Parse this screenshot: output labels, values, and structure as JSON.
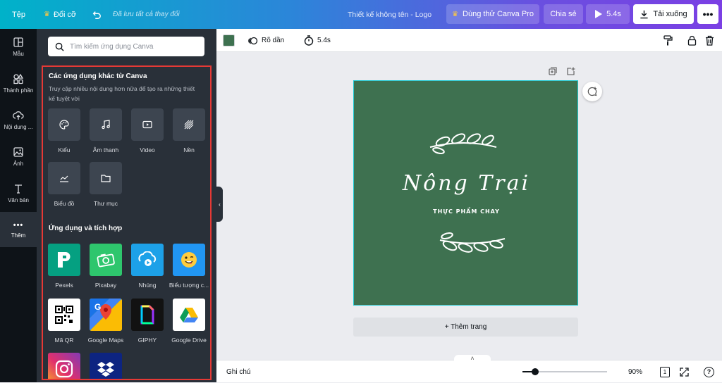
{
  "topbar": {
    "file_label": "Tệp",
    "resize_label": "Đổi cỡ",
    "saved_status": "Đã lưu tất cả thay đổi",
    "doc_title": "Thiết kế không tên - Logo",
    "try_pro_label": "Dùng thử Canva Pro",
    "share_label": "Chia sẻ",
    "play_duration": "5.4s",
    "download_label": "Tải xuống"
  },
  "rail": {
    "items": [
      {
        "label": "Mẫu",
        "icon": "template-icon"
      },
      {
        "label": "Thành phần",
        "icon": "elements-icon"
      },
      {
        "label": "Nội dung ...",
        "icon": "upload-icon"
      },
      {
        "label": "Ảnh",
        "icon": "photo-icon"
      },
      {
        "label": "Văn bản",
        "icon": "text-icon"
      },
      {
        "label": "Thêm",
        "icon": "more-icon"
      }
    ]
  },
  "panel": {
    "search_placeholder": "Tìm kiếm ứng dụng Canva",
    "section1_title": "Các ứng dụng khác từ Canva",
    "section1_desc": "Truy cập nhiều nội dung hơn nữa để tạo ra những thiết kế tuyệt vời",
    "tools": [
      {
        "label": "Kiểu",
        "icon": "palette-icon"
      },
      {
        "label": "Âm thanh",
        "icon": "music-icon"
      },
      {
        "label": "Video",
        "icon": "video-icon"
      },
      {
        "label": "Nền",
        "icon": "background-pattern-icon"
      },
      {
        "label": "Biểu đồ",
        "icon": "chart-icon"
      },
      {
        "label": "Thư mục",
        "icon": "folder-icon"
      }
    ],
    "section2_title": "Ứng dụng và tích hợp",
    "apps": [
      {
        "label": "Pexels",
        "color": "#05a081"
      },
      {
        "label": "Pixabay",
        "color": "#2ec66d"
      },
      {
        "label": "Nhúng",
        "color": "#1da1e8"
      },
      {
        "label": "Biểu tượng c...",
        "color": "#2196f3"
      },
      {
        "label": "Mã QR",
        "color": "#ffffff"
      },
      {
        "label": "Google Maps",
        "color": "#ffffff"
      },
      {
        "label": "GIPHY",
        "color": "#121212"
      },
      {
        "label": "Google Drive",
        "color": "#ffffff"
      },
      {
        "label": "Instagram",
        "color": "#e1306c"
      },
      {
        "label": "Dropbox",
        "color": "#0d2481"
      }
    ]
  },
  "editor_toolbar": {
    "color_swatch": "#3e7150",
    "fade_label": "Rõ dần",
    "duration": "5.4s"
  },
  "design": {
    "title": "Nông Trại",
    "subtitle": "THỰC PHẨM CHAY",
    "background": "#3e7150"
  },
  "add_page_label": "+ Thêm trang",
  "bottombar": {
    "notes_label": "Ghi chú",
    "zoom": "90%",
    "page_count": "1",
    "zoom_fraction": 0.15
  }
}
